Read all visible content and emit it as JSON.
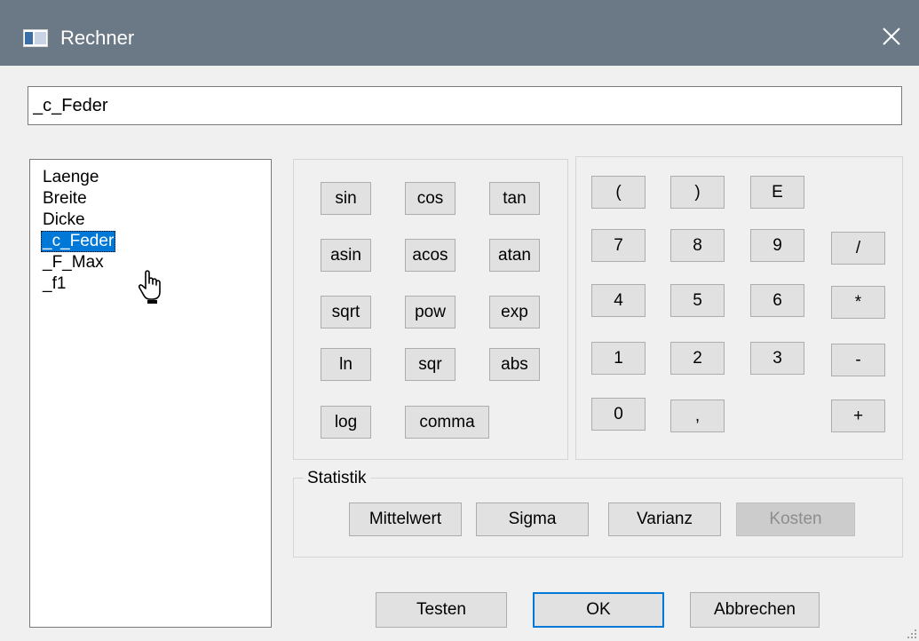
{
  "window": {
    "title": "Rechner",
    "close_glyph": "✕"
  },
  "expression": {
    "value": "_c_Feder"
  },
  "variables": {
    "items": [
      {
        "label": "Laenge",
        "selected": false
      },
      {
        "label": "Breite",
        "selected": false
      },
      {
        "label": "Dicke",
        "selected": false
      },
      {
        "label": "_c_Feder",
        "selected": true
      },
      {
        "label": "_F_Max",
        "selected": false
      },
      {
        "label": "_f1",
        "selected": false
      }
    ]
  },
  "functions": {
    "sin": "sin",
    "cos": "cos",
    "tan": "tan",
    "asin": "asin",
    "acos": "acos",
    "atan": "atan",
    "sqrt": "sqrt",
    "pow": "pow",
    "exp": "exp",
    "ln": "ln",
    "sqr": "sqr",
    "abs": "abs",
    "log": "log",
    "comma": "comma"
  },
  "keypad": {
    "lparen": "(",
    "rparen": ")",
    "e": "E",
    "n7": "7",
    "n8": "8",
    "n9": "9",
    "div": "/",
    "n4": "4",
    "n5": "5",
    "n6": "6",
    "mul": "*",
    "n1": "1",
    "n2": "2",
    "n3": "3",
    "sub": "-",
    "n0": "0",
    "dot": ",",
    "add": "+"
  },
  "statistik": {
    "label": "Statistik",
    "mittelwert": "Mittelwert",
    "sigma": "Sigma",
    "varianz": "Varianz",
    "kosten": "Kosten"
  },
  "footer": {
    "testen": "Testen",
    "ok": "OK",
    "abbrechen": "Abbrechen"
  },
  "colors": {
    "titlebar": "#6b7886",
    "selection": "#0078d7",
    "default_border": "#0078d7"
  }
}
